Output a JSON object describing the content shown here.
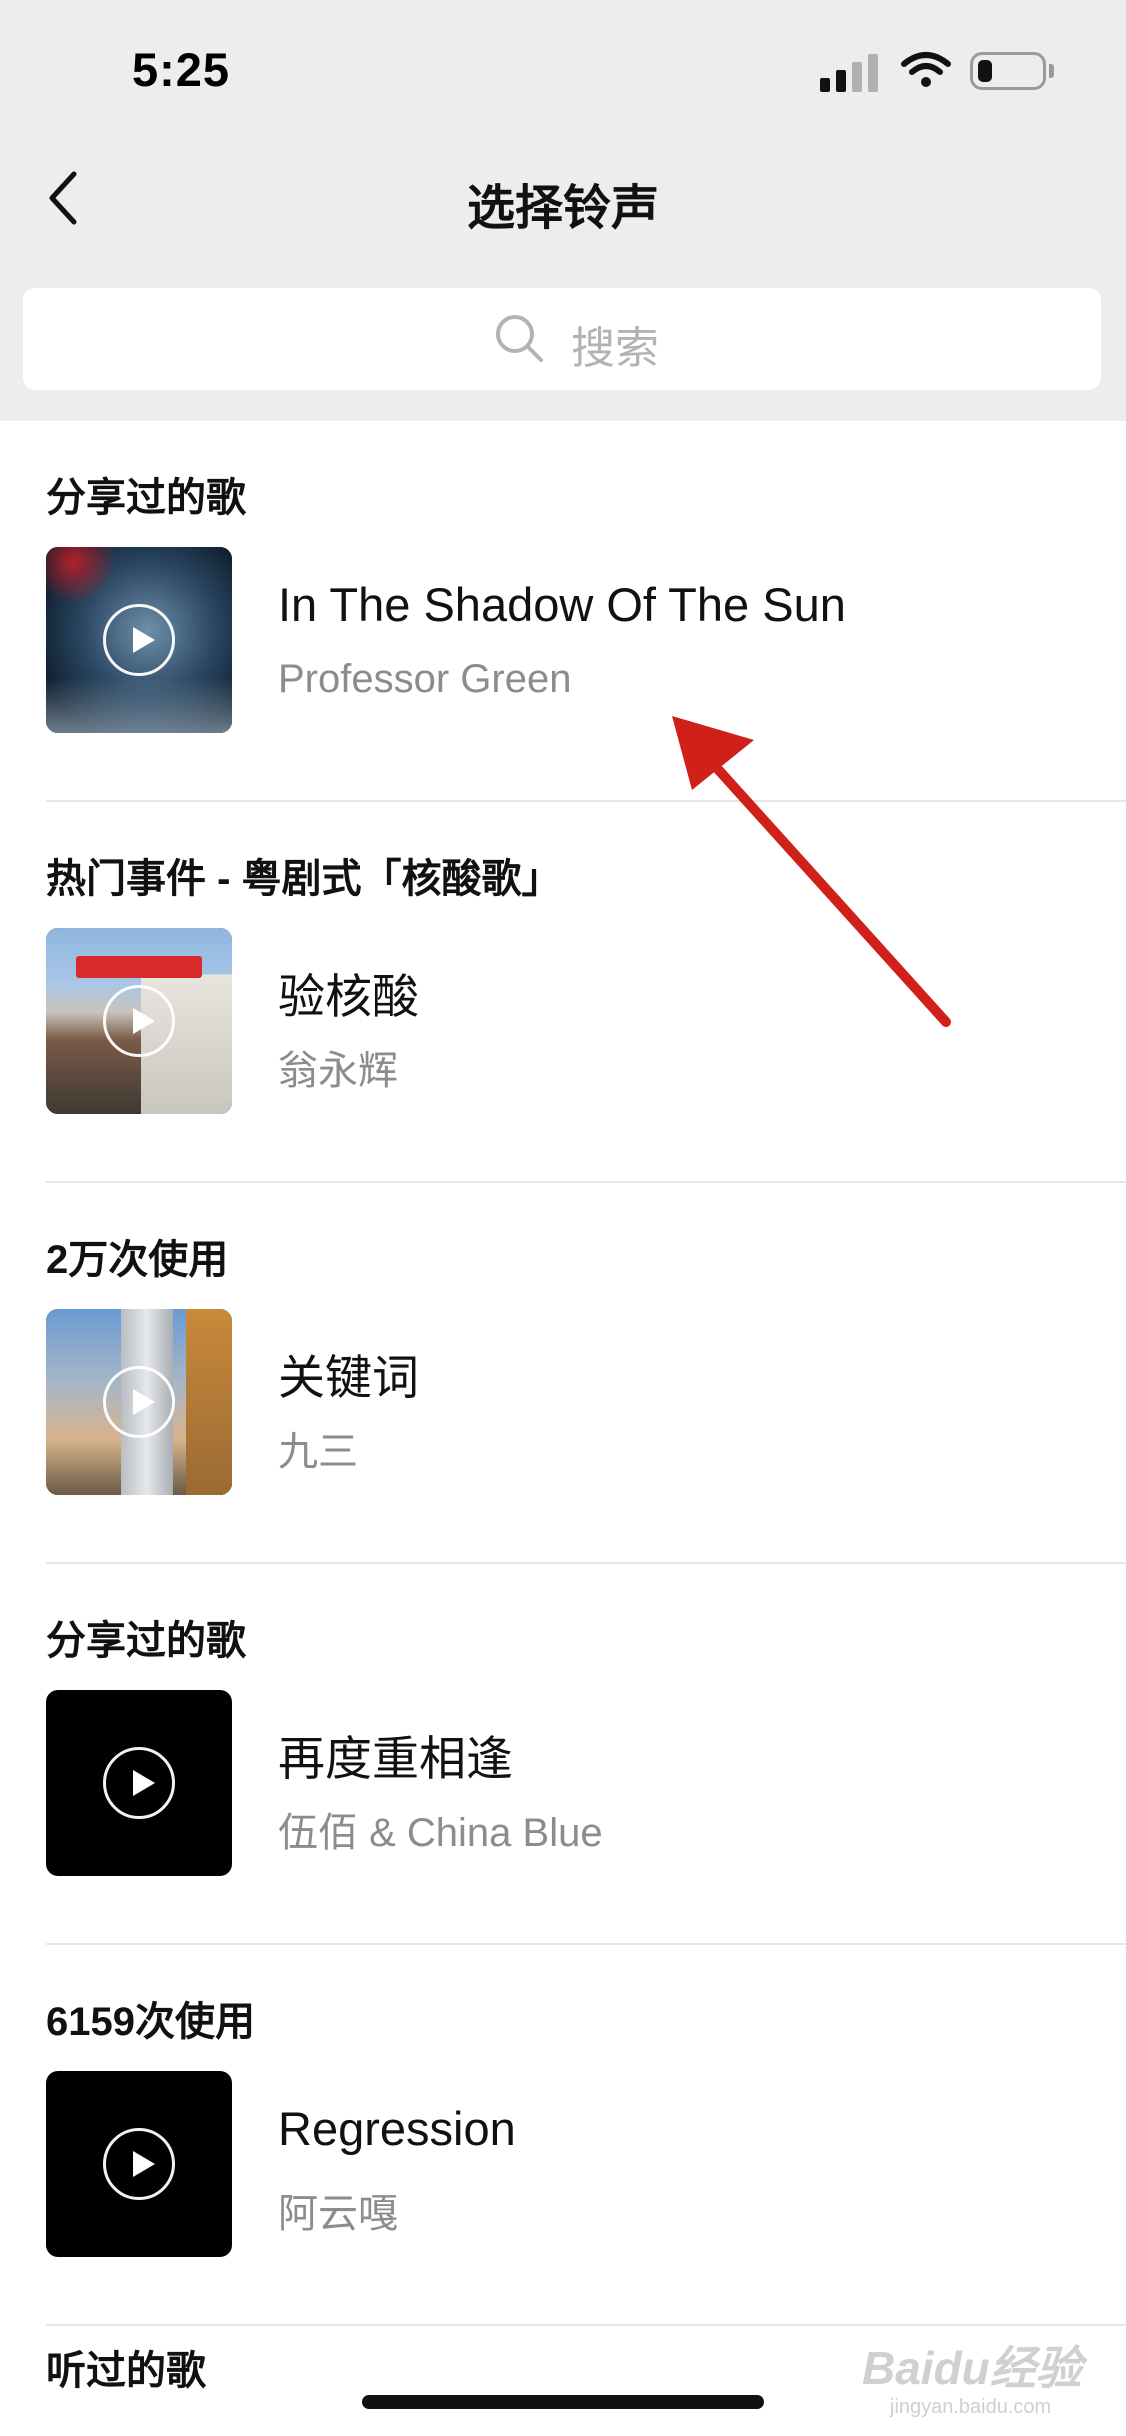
{
  "status_bar": {
    "time": "5:25"
  },
  "nav": {
    "title": "选择铃声"
  },
  "search": {
    "placeholder": "搜索"
  },
  "sections": [
    {
      "title": "分享过的歌",
      "song": {
        "title": "In The Shadow Of The Sun",
        "artist": "Professor Green"
      }
    },
    {
      "title": "热门事件 - 粤剧式「核酸歌」",
      "song": {
        "title": "验核酸",
        "artist": "翁永辉"
      }
    },
    {
      "title": "2万次使用",
      "song": {
        "title": "关键词",
        "artist": "九三"
      }
    },
    {
      "title": "分享过的歌",
      "song": {
        "title": "再度重相逢",
        "artist": "伍佰 & China Blue"
      }
    },
    {
      "title": "6159次使用",
      "song": {
        "title": "Regression",
        "artist": "阿云嘎"
      }
    }
  ],
  "last_section": {
    "title": "听过的歌"
  },
  "annotation": {
    "color": "#d0201a"
  },
  "watermark": {
    "main": "Baidu经验",
    "sub": "jingyan.baidu.com"
  },
  "icons": {
    "back": "chevron-left-icon",
    "search": "search-icon",
    "play": "play-icon",
    "signal": "signal-icon",
    "wifi": "wifi-icon",
    "battery": "battery-icon"
  }
}
